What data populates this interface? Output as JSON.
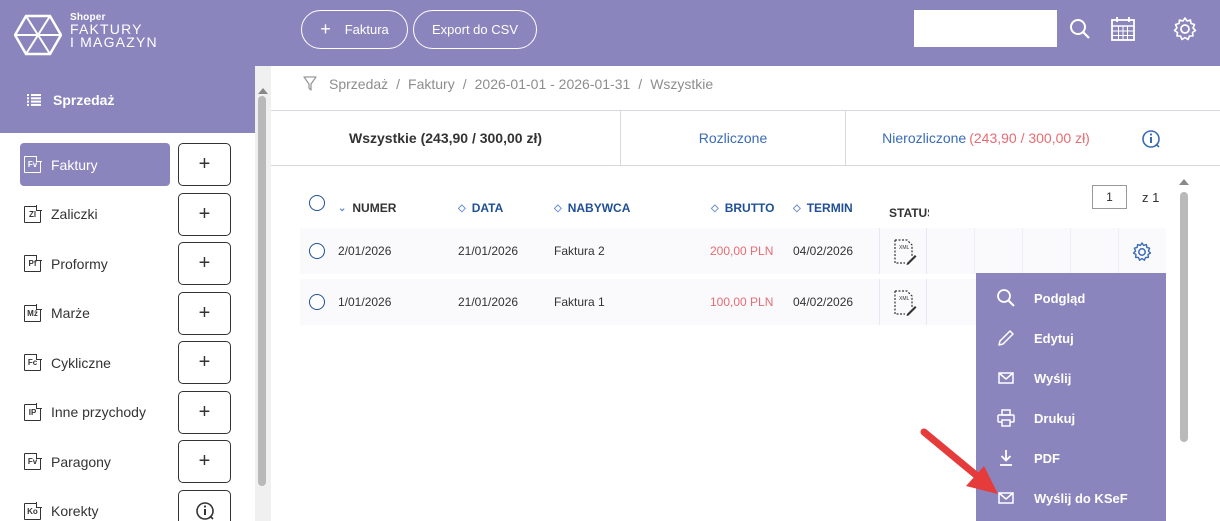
{
  "logo": {
    "small": "Shoper",
    "line1": "FAKTURY",
    "line2": "I MAGAZYN"
  },
  "sidebar": {
    "section_title": "Sprzedaż",
    "items": [
      {
        "label": "Faktury",
        "abbr": "Fv",
        "active": true
      },
      {
        "label": "Zaliczki",
        "abbr": "Zl"
      },
      {
        "label": "Proformy",
        "abbr": "Pf"
      },
      {
        "label": "Marże",
        "abbr": "Mż"
      },
      {
        "label": "Cykliczne",
        "abbr": "Fc"
      },
      {
        "label": "Inne przychody",
        "abbr": "IP"
      },
      {
        "label": "Paragony",
        "abbr": "Fv"
      },
      {
        "label": "Korekty",
        "abbr": "Ko"
      }
    ],
    "add_label": "+"
  },
  "toolbar": {
    "invoice_label": "Faktura",
    "invoice_plus": "+",
    "export_label": "Export do CSV",
    "search_value": ""
  },
  "breadcrumb": {
    "items": [
      "Sprzedaż",
      "Faktury",
      "2026-01-01 - 2026-01-31",
      "Wszystkie"
    ],
    "sep": "/"
  },
  "tabs": {
    "all": "Wszystkie (243,90 / 300,00 zł)",
    "settled": "Rozliczone",
    "unsettled": "Nierozliczone",
    "unsettled_amount": "(243,90 / 300,00 zł)"
  },
  "table": {
    "headers": {
      "numer": "NUMER",
      "data": "DATA",
      "nabywca": "NABYWCA",
      "brutto": "BRUTTO",
      "termin": "TERMIN",
      "status": "STATUS"
    },
    "rows": [
      {
        "numer": "2/01/2026",
        "data": "21/01/2026",
        "nabywca": "Faktura 2",
        "brutto": "200,00 PLN",
        "termin": "04/02/2026"
      },
      {
        "numer": "1/01/2026",
        "data": "21/01/2026",
        "nabywca": "Faktura 1",
        "brutto": "100,00 PLN",
        "termin": "04/02/2026"
      }
    ],
    "page": "1",
    "page_of": "z 1"
  },
  "menu": {
    "items": [
      "Podgląd",
      "Edytuj",
      "Wyślij",
      "Drukuj",
      "PDF",
      "Wyślij do KSeF"
    ]
  },
  "colors": {
    "brand": "#8b85bd",
    "link": "#3a6bb5",
    "amount": "#e76c73",
    "arrow": "#e53b3b"
  }
}
